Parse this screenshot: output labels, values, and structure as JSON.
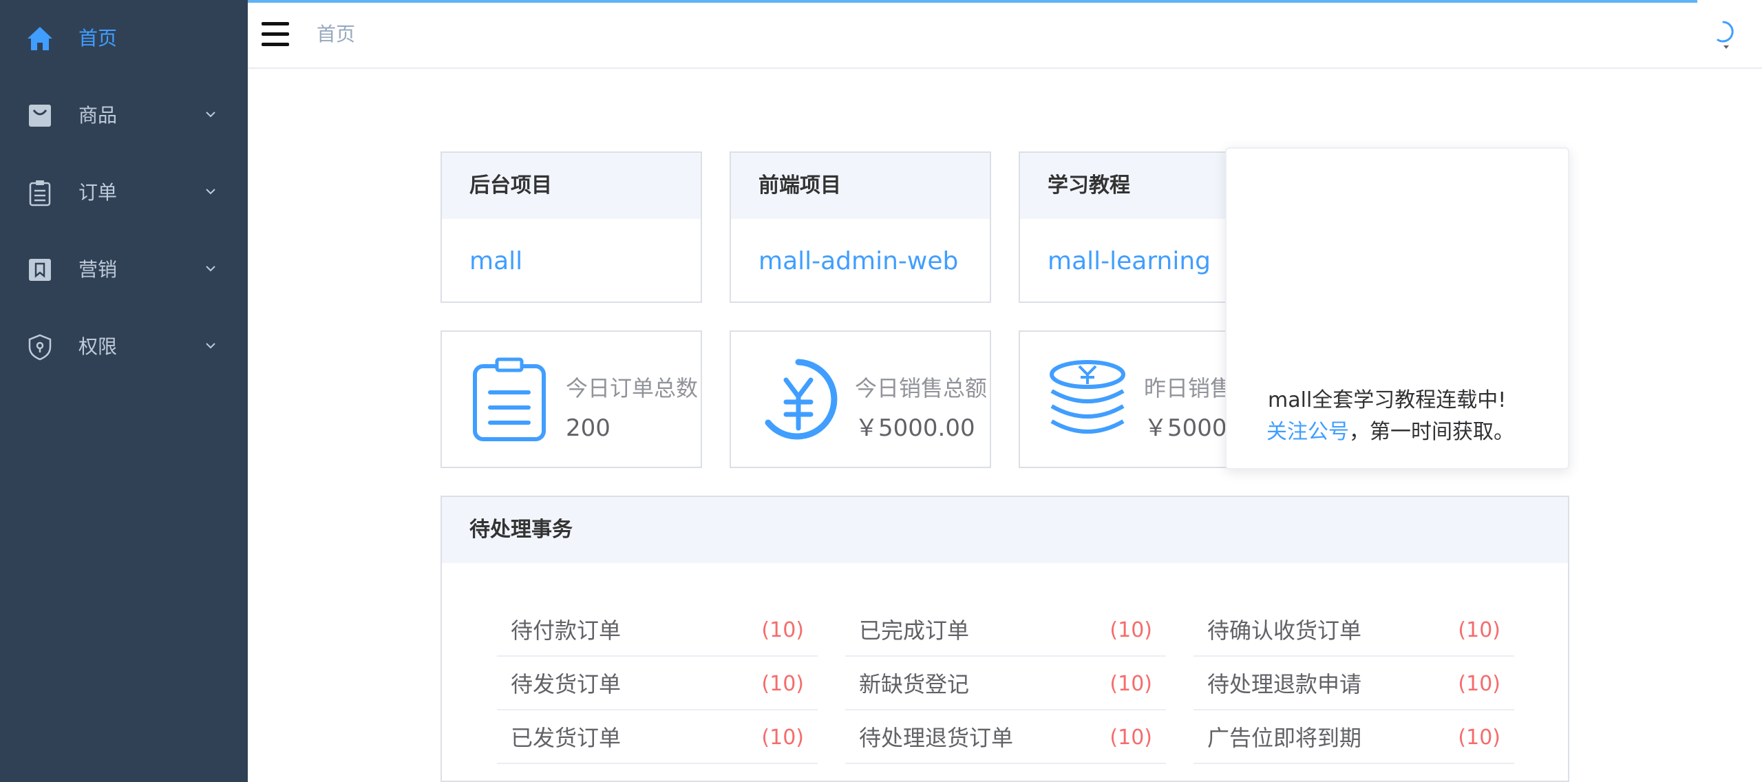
{
  "sidebar": {
    "items": [
      {
        "label": "首页",
        "icon": "home-icon",
        "active": true
      },
      {
        "label": "商品",
        "icon": "shopping-bag-icon"
      },
      {
        "label": "订单",
        "icon": "clipboard-icon"
      },
      {
        "label": "营销",
        "icon": "bookmark-icon"
      },
      {
        "label": "权限",
        "icon": "shield-icon"
      }
    ]
  },
  "navbar": {
    "breadcrumb": "首页"
  },
  "projects": [
    {
      "title": "后台项目",
      "link": "mall"
    },
    {
      "title": "前端项目",
      "link": "mall-admin-web"
    },
    {
      "title": "学习教程",
      "link": "mall-learning"
    }
  ],
  "stats": [
    {
      "title": "今日订单总数",
      "value": "200",
      "icon": "clipboard-list-icon"
    },
    {
      "title": "今日销售总额",
      "value": "￥5000.00",
      "icon": "yen-circle-icon"
    },
    {
      "title": "昨日销售",
      "value": "￥5000",
      "icon": "coins-stack-icon"
    }
  ],
  "popover": {
    "line1": "mall全套学习教程连载中!",
    "link": "关注公号",
    "line2_rest": "，第一时间获取。"
  },
  "pending": {
    "title": "待处理事务",
    "columns": [
      [
        {
          "label": "待付款订单",
          "count": "(10)"
        },
        {
          "label": "待发货订单",
          "count": "(10)"
        },
        {
          "label": "已发货订单",
          "count": "(10)"
        }
      ],
      [
        {
          "label": "已完成订单",
          "count": "(10)"
        },
        {
          "label": "新缺货登记",
          "count": "(10)"
        },
        {
          "label": "待处理退货订单",
          "count": "(10)"
        }
      ],
      [
        {
          "label": "待确认收货订单",
          "count": "(10)"
        },
        {
          "label": "待处理退款申请",
          "count": "(10)"
        },
        {
          "label": "广告位即将到期",
          "count": "(10)"
        }
      ]
    ]
  },
  "colors": {
    "sidebar_bg": "#304156",
    "accent": "#409eff",
    "danger": "#f56c6c"
  }
}
